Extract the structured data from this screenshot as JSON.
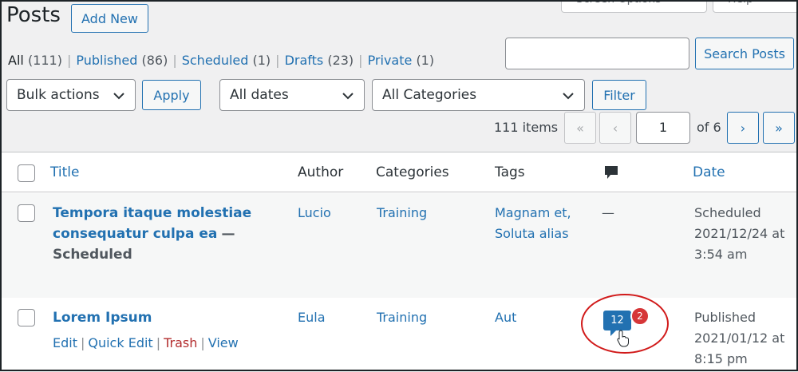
{
  "header": {
    "title": "Posts",
    "add_new": "Add New",
    "screen_options": "Screen Options",
    "help": "Help"
  },
  "filters": {
    "all": {
      "label": "All",
      "count": "(111)"
    },
    "published": {
      "label": "Published",
      "count": "(86)"
    },
    "scheduled": {
      "label": "Scheduled",
      "count": "(1)"
    },
    "drafts": {
      "label": "Drafts",
      "count": "(23)"
    },
    "private": {
      "label": "Private",
      "count": "(1)"
    },
    "separator": "|"
  },
  "search": {
    "placeholder": "",
    "button": "Search Posts"
  },
  "toolbar": {
    "bulk_actions": "Bulk actions",
    "apply": "Apply",
    "dates": "All dates",
    "categories": "All Categories",
    "filter": "Filter"
  },
  "pagination": {
    "items": "111 items",
    "first": "«",
    "prev": "‹",
    "current": "1",
    "of_pages": "of 6",
    "next": "›",
    "last": "»"
  },
  "table": {
    "columns": {
      "title": "Title",
      "author": "Author",
      "categories": "Categories",
      "tags": "Tags",
      "comments_icon": "comment-icon",
      "date": "Date"
    },
    "rows": [
      {
        "title_line1": "Tempora itaque molestiae",
        "title_line2": "consequatur culpa ea",
        "dash": "—",
        "state": "Scheduled",
        "author": "Lucio",
        "category": "Training",
        "tags_line1": "Magnam et,",
        "tags_line2": "Soluta alias",
        "comments": "—",
        "date_status": "Scheduled",
        "date_line1": "2021/12/24 at",
        "date_line2": "3:54 am"
      },
      {
        "title_line1": "Lorem Ipsum",
        "author": "Eula",
        "category": "Training",
        "tags_line1": "Aut",
        "comments": "12",
        "pending": "2",
        "actions": {
          "edit": "Edit",
          "quick_edit": "Quick Edit",
          "trash": "Trash",
          "view": "View",
          "sep": "|"
        },
        "date_status": "Published",
        "date_line1": "2021/01/12 at",
        "date_line2": "8:15 pm"
      }
    ]
  },
  "colors": {
    "link": "#2271b1",
    "trash": "#b32d2e",
    "pending_badge": "#d63638",
    "annotation": "#d11a1a"
  }
}
